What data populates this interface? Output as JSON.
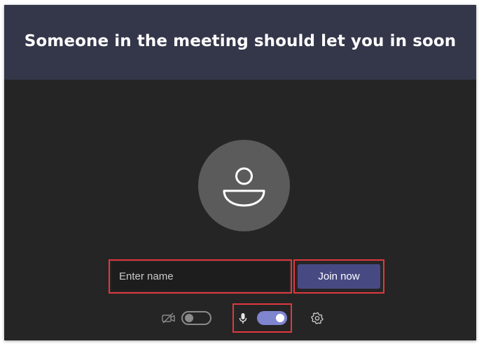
{
  "header": {
    "title": "Someone in the meeting should let you in soon"
  },
  "join_form": {
    "name_placeholder": "Enter name",
    "name_value": "",
    "join_label": "Join now"
  },
  "device_controls": {
    "video_icon": "camera-off-icon",
    "video_enabled": false,
    "mic_icon": "microphone-icon",
    "mic_enabled": true,
    "settings_icon": "gear-icon"
  },
  "colors": {
    "header_bg": "#34364a",
    "body_bg": "#262525",
    "accent": "#474a82",
    "toggle_on": "#7f85cf",
    "highlight": "#e0393e"
  }
}
